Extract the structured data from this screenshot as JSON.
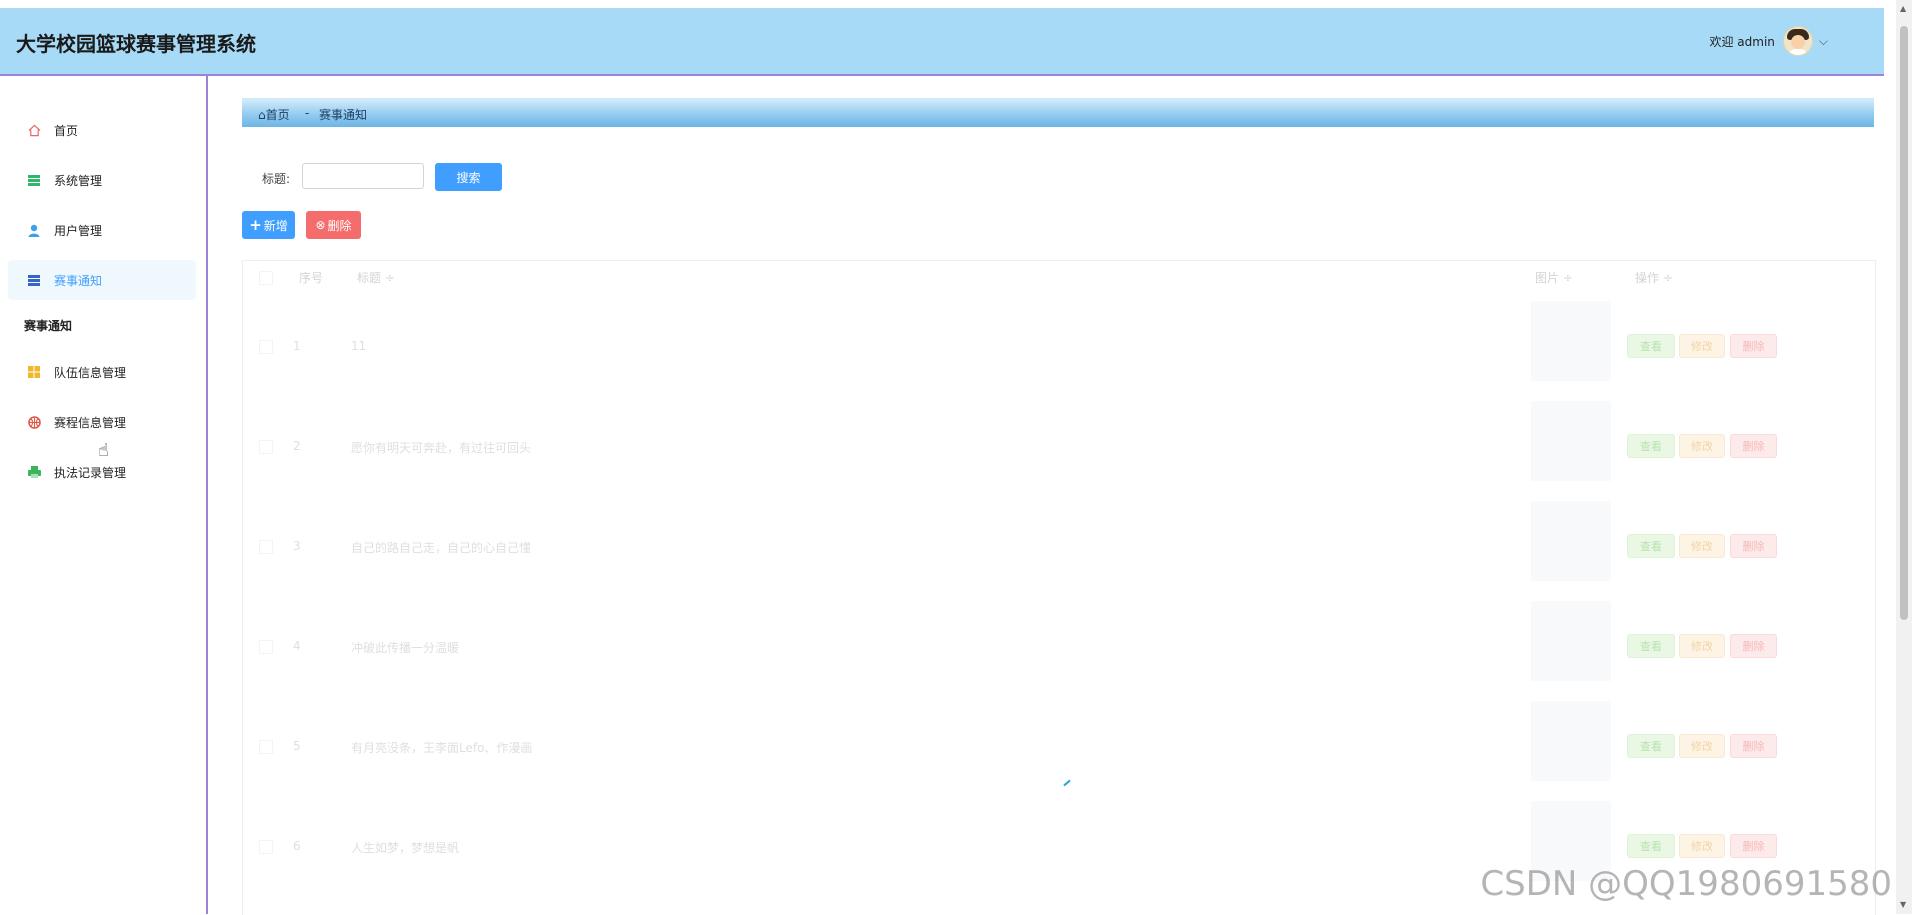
{
  "header": {
    "title": "大学校园篮球赛事管理系统",
    "welcome": "欢迎 admin",
    "caret": "⌵"
  },
  "sidebar": {
    "items": [
      {
        "label": "首页",
        "icon": "home-icon",
        "color": "#e06c6c"
      },
      {
        "label": "系统管理",
        "icon": "list-icon",
        "color": "#2fb66b"
      },
      {
        "label": "用户管理",
        "icon": "user-icon",
        "color": "#3ea0e8"
      },
      {
        "label": "赛事通知",
        "icon": "list-icon",
        "color": "#3565c9",
        "active": true
      }
    ],
    "section_label": "赛事通知",
    "items2": [
      {
        "label": "队伍信息管理",
        "icon": "grid-icon",
        "color": "#f0b72f"
      },
      {
        "label": "赛程信息管理",
        "icon": "globe-icon",
        "color": "#e05a4a"
      },
      {
        "label": "执法记录管理",
        "icon": "printer-icon",
        "color": "#3bb45c"
      }
    ]
  },
  "breadcrumb": {
    "home": "首页",
    "separator": "-",
    "current": "赛事通知"
  },
  "search": {
    "label": "标题:",
    "placeholder": "",
    "button": "搜索"
  },
  "actions": {
    "add": "新增",
    "delete": "删除"
  },
  "table": {
    "headers": [
      "序号",
      "标题 ÷",
      "图片 ÷",
      "操作 ÷"
    ],
    "rows": [
      {
        "index": "1",
        "title": "11"
      },
      {
        "index": "2",
        "title": "愿你有明天可奔赴，有过往可回头"
      },
      {
        "index": "3",
        "title": "自己的路自己走，自己的心自己懂"
      },
      {
        "index": "4",
        "title": "冲破此传播一分温暖"
      },
      {
        "index": "5",
        "title": "有月亮没条，王李面Lefo、作漫画"
      },
      {
        "index": "6",
        "title": "人生如梦，梦想是帆"
      }
    ],
    "ops": {
      "view": "查看",
      "edit": "修改",
      "delete": "删除"
    }
  },
  "watermark": "CSDN @QQ1980691580",
  "colors": {
    "header_bg": "#a6daf7",
    "primary": "#409eff",
    "danger": "#f56c6c",
    "accent_border": "#9b84d8"
  }
}
